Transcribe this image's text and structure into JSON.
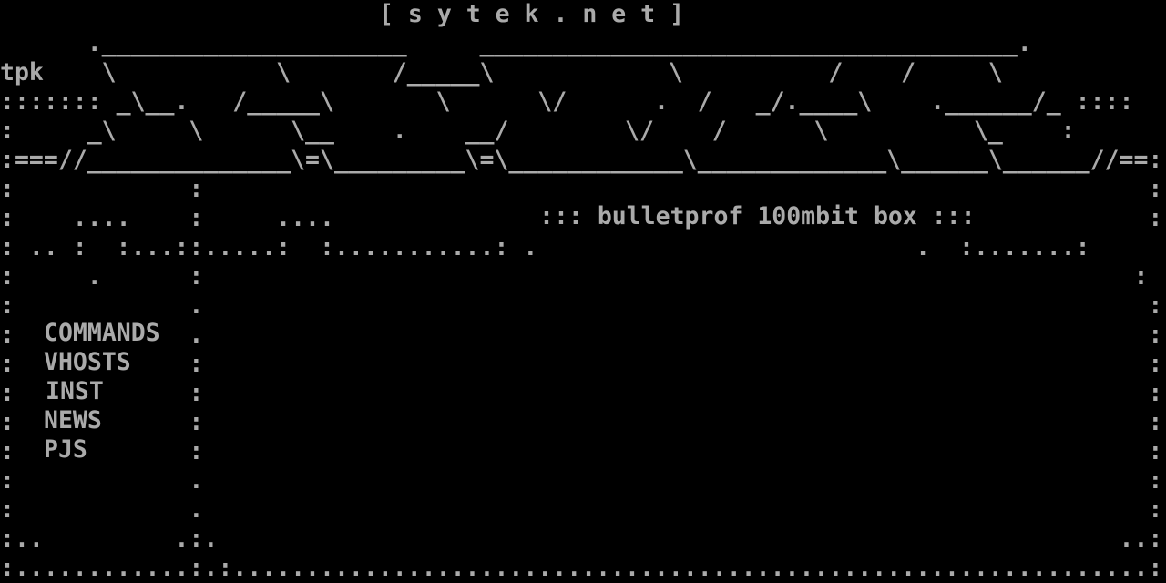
{
  "header": {
    "site_title": "[ s y t e k . n e t ]"
  },
  "art": {
    "line1": "      ._____________________     _____________________________________.",
    "line2": "tpk    \\           \\       /_____\\            \\          /    /     \\",
    "line3": "::::::: _\\__.   /_____\\       \\      \\/      .  /   _/.____\\    .______/_ ::::",
    "line4": ":     _\\     \\      \\__    .    __/        \\/    /      \\          \\_    :",
    "line5": ":===//______________\\=\\_________\\=\\____________\\_____________\\______\\______//==:",
    "line6": ":            :                                                                 :",
    "line7": ":    ....    :     ....                                                        :",
    "line8": ": .. :  :...::.....:  :...........: .                          .  :.......:",
    "line9": ":     .      :                                                                :",
    "line10": ":            .                                                                 :",
    "line11": ":            .                                                                 :",
    "line12": ":            :                                                                 :",
    "line13": ":            :                                                                 :",
    "line14": ":            :                                                                 :",
    "line15": ":            :                                                                 :",
    "line16": ":            .                                                                 :",
    "line17": ":            .                                                                 :",
    "line18": ":..         .:.                                                              ..:",
    "line19": ":............:.:...............................................................:"
  },
  "tagline": "::: bulletprof 100mbit box :::",
  "menu": {
    "items": [
      {
        "label": "COMMANDS"
      },
      {
        "label": "VHOSTS"
      },
      {
        "label": "INST"
      },
      {
        "label": "NEWS"
      },
      {
        "label": "PJS"
      }
    ]
  },
  "colors": {
    "background": "#000000",
    "text": "#aaaaaa"
  }
}
